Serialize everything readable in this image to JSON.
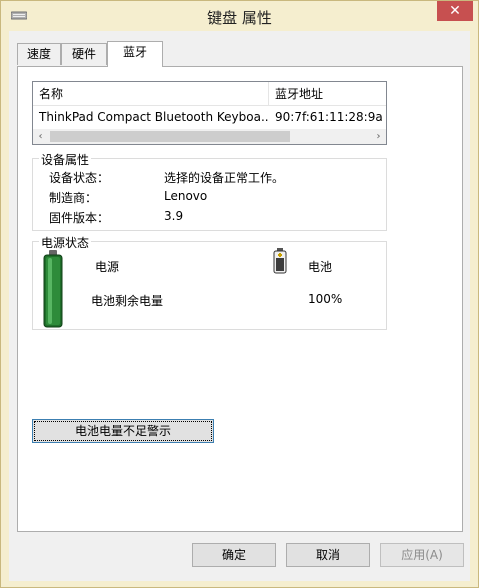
{
  "window": {
    "title": "键盘 属性",
    "close_glyph": "✕"
  },
  "tabs": [
    {
      "label": "速度",
      "active": false
    },
    {
      "label": "硬件",
      "active": false
    },
    {
      "label": "蓝牙",
      "active": true
    }
  ],
  "device_list": {
    "columns": [
      "名称",
      "蓝牙地址"
    ],
    "rows": [
      {
        "name": "ThinkPad Compact Bluetooth Keyboa...",
        "address": "90:7f:61:11:28:9a"
      }
    ],
    "scroll_left": "‹",
    "scroll_right": "›"
  },
  "device_properties": {
    "legend": "设备属性",
    "items": [
      {
        "label": "设备状态：",
        "value": "选择的设备正常工作。"
      },
      {
        "label": "制造商：",
        "value": "Lenovo"
      },
      {
        "label": "固件版本：",
        "value": "3.9"
      }
    ]
  },
  "power_status": {
    "legend": "电源状态",
    "power_label": "电源",
    "battery_label": "电池",
    "remaining_label": "电池剩余电量",
    "remaining_value": "100%",
    "battery_level": 1.0,
    "battery_color": "#2e8b3a"
  },
  "low_battery_button": "电池电量不足警示",
  "footer": {
    "ok": "确定",
    "cancel": "取消",
    "apply": "应用(A)"
  }
}
